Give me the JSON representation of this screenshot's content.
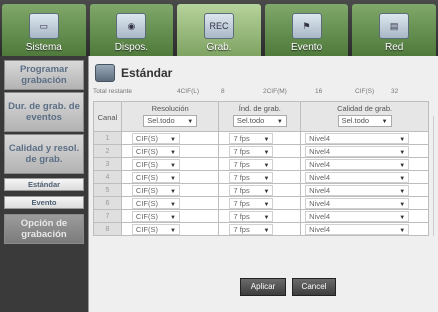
{
  "nav": {
    "tabs": [
      {
        "label": "Sistema",
        "icon": "monitor-icon"
      },
      {
        "label": "Dispos.",
        "icon": "camera-icon"
      },
      {
        "label": "Grab.",
        "icon": "record-icon"
      },
      {
        "label": "Evento",
        "icon": "event-icon"
      },
      {
        "label": "Red",
        "icon": "network-icon"
      }
    ],
    "active_index": 2
  },
  "sidebar": {
    "items": [
      {
        "label": "Programar grabación"
      },
      {
        "label": "Dur. de grab. de eventos"
      },
      {
        "label": "Calidad y resol. de grab."
      },
      {
        "label": "Estándar"
      },
      {
        "label": "Evento"
      },
      {
        "label": "Opción de grabación"
      }
    ]
  },
  "panel": {
    "title": "Estándar",
    "totals": {
      "label": "Total restante",
      "cif4_label": "4CIF(L)",
      "cif4_value": "8",
      "cif2_label": "2CIF(M)",
      "cif2_value": "16",
      "cif_label": "CIF(S)",
      "cif_value": "32"
    },
    "table": {
      "headers": {
        "canal": "Canal",
        "resolucion": "Resolución",
        "ips": "Índ. de grab.",
        "calidad": "Calidad de grab."
      },
      "select_all": "Sel.todo",
      "rows": [
        {
          "ch": "1",
          "res": "CIF(S)",
          "ips": "7 fps",
          "q": "Nivel4"
        },
        {
          "ch": "2",
          "res": "CIF(S)",
          "ips": "7 fps",
          "q": "Nivel4"
        },
        {
          "ch": "3",
          "res": "CIF(S)",
          "ips": "7 fps",
          "q": "Nivel4"
        },
        {
          "ch": "4",
          "res": "CIF(S)",
          "ips": "7 fps",
          "q": "Nivel4"
        },
        {
          "ch": "5",
          "res": "CIF(S)",
          "ips": "7 fps",
          "q": "Nivel4"
        },
        {
          "ch": "6",
          "res": "CIF(S)",
          "ips": "7 fps",
          "q": "Nivel4"
        },
        {
          "ch": "7",
          "res": "CIF(S)",
          "ips": "7 fps",
          "q": "Nivel4"
        },
        {
          "ch": "8",
          "res": "CIF(S)",
          "ips": "7 fps",
          "q": "Nivel4"
        }
      ]
    },
    "buttons": {
      "apply": "Aplicar",
      "cancel": "Cancel"
    }
  }
}
